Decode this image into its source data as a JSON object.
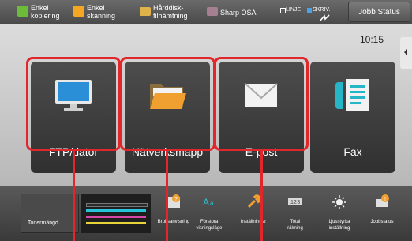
{
  "topbar": {
    "quick_buttons": [
      {
        "label": "Enkel\nkopiering",
        "color": "#6dbb3a"
      },
      {
        "label": "Enkel\nskanning",
        "color": "#f5a623"
      },
      {
        "label": "Hårddisk-\nfilhämtning",
        "color": "#e0b24a"
      },
      {
        "label": "Sharp OSA",
        "color": "#a58090"
      }
    ],
    "linje": "LINJE",
    "skriv": "SKRIV.",
    "job_status": "Jobb Status"
  },
  "home": {
    "time": "10:15",
    "tiles": [
      {
        "label": "FTP/dator",
        "icon": "monitor-icon"
      },
      {
        "label": "Nätverksmapp",
        "icon": "folder-icon"
      },
      {
        "label": "E-post",
        "icon": "envelope-icon"
      },
      {
        "label": "Fax",
        "icon": "fax-icon"
      }
    ],
    "page_count": 5,
    "active_page": 2,
    "highlight_color": "#e1262c"
  },
  "bottombar": {
    "toner_label": "Tonermängd",
    "toner_colors": [
      "#2a2a2a",
      "#27c3d8",
      "#d848a8",
      "#e8d23a"
    ],
    "items": [
      {
        "label": "Bruksanvisning",
        "icon": "help-icon"
      },
      {
        "label": "Förstora\nvisningsläge",
        "icon": "zoom-text-icon"
      },
      {
        "label": "Inställningar",
        "icon": "wrench-icon"
      },
      {
        "label": "Total\nräkning",
        "icon": "counter-icon"
      },
      {
        "label": "Ljusstyrka\ninställning",
        "icon": "brightness-icon"
      },
      {
        "label": "Jobbstatus",
        "icon": "job-status-icon"
      }
    ]
  }
}
